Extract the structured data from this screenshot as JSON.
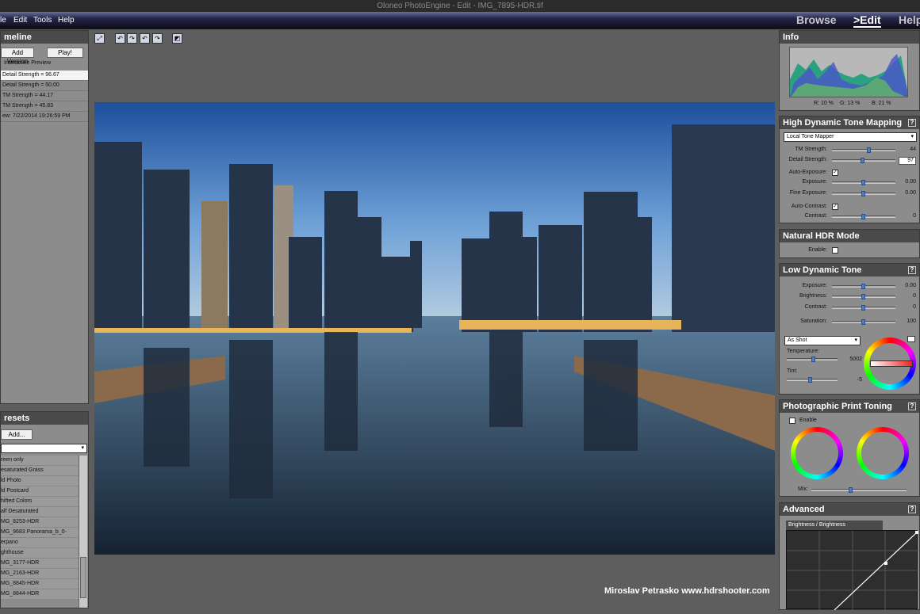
{
  "app": {
    "title": "Oloneo PhotoEngine - Edit - IMG_7895-HDR.tif"
  },
  "menu": [
    "le",
    "Edit",
    "Tools",
    "Help"
  ],
  "nav": {
    "browse": "Browse",
    "edit": ">Edit",
    "help": "Help"
  },
  "timeline": {
    "title": "meline",
    "add_version": "Add Version",
    "play": "Play!",
    "interactive": "Interactive Preview",
    "items": [
      "Detail Strength = 96.67",
      "Detail Strength = 50.00",
      "TM Strength = 44.17",
      "TM Strength = 45.83",
      "ew: 7/22/2014 19:26:59 PM"
    ]
  },
  "presets": {
    "title": "resets",
    "add": "Add...",
    "items": [
      "reen only",
      "esaturated Grass",
      "ld Photo",
      "ld Postcard",
      "hifted Colors",
      "alf Desaturated",
      "MG_8253-HDR",
      "MG_9683 Panorama_b_0-HDR",
      "erpano",
      "ghthouse",
      "MG_3177-HDR",
      "MG_2163-HDR",
      "MG_8845-HDR",
      "MG_8844-HDR"
    ]
  },
  "toolbar": {
    "fit": "⤢",
    "b1": "↶",
    "b2": "↷",
    "b3": "↶",
    "b4": "↷",
    "crop": "◩"
  },
  "watermark": "Miroslav  Petrasko  www.hdrshooter.com",
  "info": {
    "title": "Info",
    "r": "R: 10 %",
    "g": "G: 13 %",
    "b": "B: 21 %"
  },
  "hdtm": {
    "title": "High Dynamic Tone Mapping",
    "help": "?",
    "mapper": "Local Tone Mapper",
    "tm_label": "TM Strength:",
    "tm_val": "44",
    "tm_pos": 0.44,
    "detail_label": "Detail Strength:",
    "detail_val": "97",
    "detail_pos": 0.35,
    "auto_exp_label": "Auto-Exposure:",
    "auto_exp": "✓",
    "exp_label": "Exposure:",
    "exp_val": "0.00",
    "fine_label": "Fine Exposure:",
    "fine_val": "0.00",
    "auto_con_label": "Auto-Contrast:",
    "auto_con": "✓",
    "con_label": "Contrast:",
    "con_val": "0"
  },
  "natural": {
    "title": "Natural HDR Mode",
    "enable": "Enable:"
  },
  "ldt": {
    "title": "Low Dynamic Tone",
    "help": "?",
    "exp_label": "Exposure:",
    "exp_val": "0.00",
    "bri_label": "Brightness:",
    "bri_val": "0",
    "con_label": "Contrast:",
    "con_val": "0",
    "sat_label": "Saturation:",
    "sat_val": "100",
    "wb": "As Shot",
    "temp_label": "Temperature:",
    "temp_val": "5002",
    "tint_label": "Tint:",
    "tint_val": "-5"
  },
  "toning": {
    "title": "Photographic Print Toning",
    "help": "?",
    "enable": "Enable",
    "mix": "Mix:"
  },
  "advanced": {
    "title": "Advanced",
    "help": "?",
    "curve": "Brightness / Brightness"
  },
  "colors": {
    "accent": "#4c7fc3",
    "panel": "#8c8c8c",
    "header": "#4a4a4a"
  }
}
